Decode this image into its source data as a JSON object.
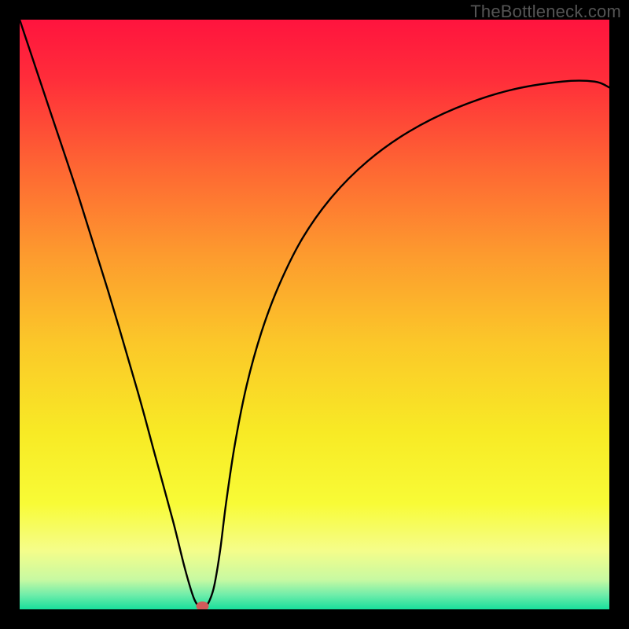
{
  "attribution": "TheBottleneck.com",
  "chart_data": {
    "type": "line",
    "title": "",
    "xlabel": "",
    "ylabel": "",
    "xlim": [
      0,
      1
    ],
    "ylim": [
      0,
      1
    ],
    "background_gradient": {
      "stops": [
        {
          "pos": 0.0,
          "color": "#ff143e"
        },
        {
          "pos": 0.1,
          "color": "#ff2d3a"
        },
        {
          "pos": 0.25,
          "color": "#fe6633"
        },
        {
          "pos": 0.4,
          "color": "#fd9b2e"
        },
        {
          "pos": 0.55,
          "color": "#fbc829"
        },
        {
          "pos": 0.7,
          "color": "#f8ea25"
        },
        {
          "pos": 0.82,
          "color": "#f8fb36"
        },
        {
          "pos": 0.9,
          "color": "#f5fd8a"
        },
        {
          "pos": 0.95,
          "color": "#c7f9a2"
        },
        {
          "pos": 0.975,
          "color": "#71edaa"
        },
        {
          "pos": 1.0,
          "color": "#18df9c"
        }
      ]
    },
    "series": [
      {
        "name": "bottleneck-curve",
        "color": "#000000",
        "x": [
          0.0,
          0.05,
          0.1,
          0.15,
          0.2,
          0.23,
          0.26,
          0.28,
          0.295,
          0.305,
          0.315,
          0.322,
          0.33,
          0.34,
          0.35,
          0.365,
          0.385,
          0.41,
          0.44,
          0.48,
          0.53,
          0.59,
          0.66,
          0.74,
          0.83,
          0.92,
          0.975,
          1.0
        ],
        "values": [
          1.0,
          0.85,
          0.7,
          0.54,
          0.37,
          0.26,
          0.15,
          0.07,
          0.02,
          0.005,
          0.005,
          0.015,
          0.04,
          0.1,
          0.18,
          0.28,
          0.38,
          0.47,
          0.55,
          0.63,
          0.7,
          0.76,
          0.81,
          0.85,
          0.88,
          0.895,
          0.895,
          0.885
        ]
      }
    ],
    "marker": {
      "x": 0.31,
      "y": 0.0,
      "color": "#d15a5a",
      "rx": 8,
      "ry": 6
    }
  }
}
